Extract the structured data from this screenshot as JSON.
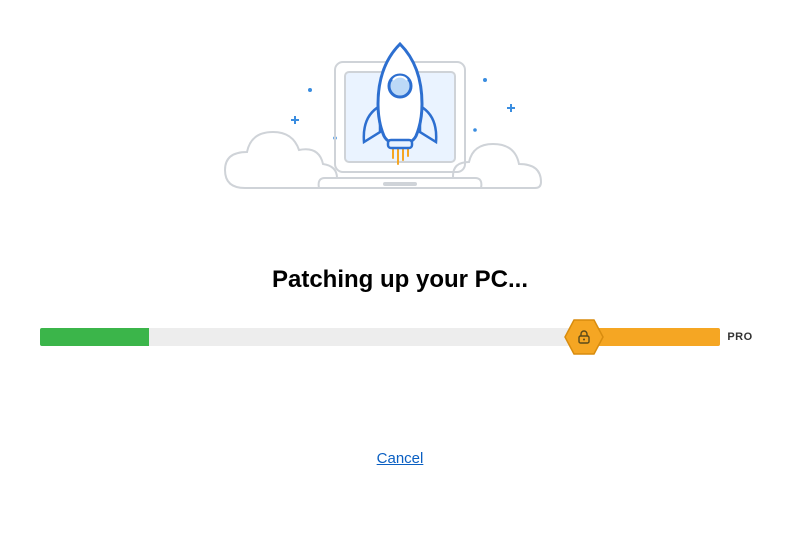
{
  "heading": "Patching up your PC...",
  "progress": {
    "green_percent": 16,
    "orange_percent": 20,
    "pro_label": "PRO"
  },
  "cancel_label": "Cancel",
  "colors": {
    "green": "#3bb54a",
    "orange": "#f5a623",
    "track": "#ededed",
    "link": "#0a5fc2"
  },
  "icons": {
    "rocket": "rocket-laptop-illustration",
    "lock": "lock-icon"
  }
}
